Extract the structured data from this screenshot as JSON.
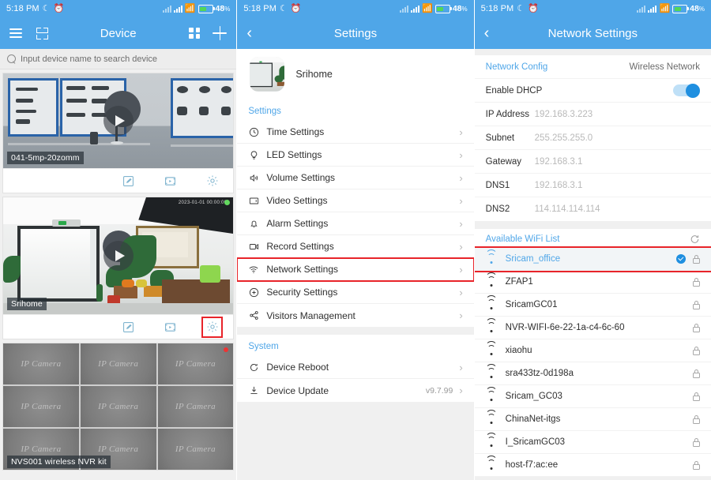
{
  "statusbar": {
    "time": "5:18 PM",
    "moon_icon": "crescent-moon-icon",
    "alarm_icon": "alarm-clock-icon",
    "battery_percent": "48",
    "battery_unit": "%"
  },
  "device_screen": {
    "title": "Device",
    "menu_icon": "hamburger-menu-icon",
    "scan_icon": "qr-scan-icon",
    "grid_icon": "grid-view-icon",
    "add_icon": "plus-add-icon",
    "search": {
      "icon": "search-icon",
      "placeholder": "Input device name to search device"
    },
    "cards": [
      {
        "label": "041-5mp-20zomm",
        "play_icon": "play-button-icon",
        "actions": [
          "edit-icon",
          "playback-icon",
          "settings-gear-icon"
        ],
        "highlight_gear": false
      },
      {
        "label": "Srihome",
        "play_icon": "play-button-icon",
        "actions": [
          "edit-icon",
          "playback-icon",
          "settings-gear-icon"
        ],
        "highlight_gear": true
      },
      {
        "label": "NVS001 wireless NVR kit",
        "channel_label": "IP Camera",
        "channels": 9
      }
    ]
  },
  "settings_screen": {
    "title": "Settings",
    "back_icon": "chevron-left-icon",
    "profile": {
      "name": "Srihome",
      "avatar": "device-thumbnail-avatar"
    },
    "sections": [
      {
        "header": "Settings",
        "items": [
          {
            "label": "Time Settings",
            "icon": "clock-icon",
            "highlight": false
          },
          {
            "label": "LED Settings",
            "icon": "lightbulb-icon",
            "highlight": false
          },
          {
            "label": "Volume Settings",
            "icon": "speaker-icon",
            "highlight": false
          },
          {
            "label": "Video Settings",
            "icon": "video-screen-icon",
            "highlight": false
          },
          {
            "label": "Alarm Settings",
            "icon": "bell-icon",
            "highlight": false
          },
          {
            "label": "Record Settings",
            "icon": "camcorder-icon",
            "highlight": false
          },
          {
            "label": "Network Settings",
            "icon": "wifi-icon",
            "highlight": true
          },
          {
            "label": "Security Settings",
            "icon": "shield-plus-icon",
            "highlight": false
          },
          {
            "label": "Visitors Management",
            "icon": "share-nodes-icon",
            "highlight": false
          }
        ]
      },
      {
        "header": "System",
        "items": [
          {
            "label": "Device Reboot",
            "icon": "reboot-icon",
            "value": "",
            "highlight": false
          },
          {
            "label": "Device Update",
            "icon": "download-icon",
            "value": "v9.7.99",
            "highlight": false
          }
        ]
      }
    ],
    "chevron": "›"
  },
  "network_screen": {
    "title": "Network Settings",
    "back_icon": "chevron-left-icon",
    "config_header": "Network Config",
    "connection_type": "Wireless Network",
    "dhcp": {
      "label": "Enable DHCP",
      "enabled": true
    },
    "fields": [
      {
        "key": "IP Address",
        "value": "192.168.3.223"
      },
      {
        "key": "Subnet",
        "value": "255.255.255.0"
      },
      {
        "key": "Gateway",
        "value": "192.168.3.1"
      },
      {
        "key": "DNS1",
        "value": "192.168.3.1"
      },
      {
        "key": "DNS2",
        "value": "114.114.114.114"
      }
    ],
    "wifi_header": "Available WiFi List",
    "refresh_icon": "refresh-icon",
    "wifi_list": [
      {
        "ssid": "Sricam_office",
        "selected": true,
        "locked": true,
        "highlight": true
      },
      {
        "ssid": "ZFAP1",
        "selected": false,
        "locked": true,
        "highlight": false
      },
      {
        "ssid": "SricamGC01",
        "selected": false,
        "locked": true,
        "highlight": false
      },
      {
        "ssid": "NVR-WIFI-6e-22-1a-c4-6c-60",
        "selected": false,
        "locked": true,
        "highlight": false
      },
      {
        "ssid": "xiaohu",
        "selected": false,
        "locked": true,
        "highlight": false
      },
      {
        "ssid": "sra433tz-0d198a",
        "selected": false,
        "locked": true,
        "highlight": false
      },
      {
        "ssid": "Sricam_GC03",
        "selected": false,
        "locked": true,
        "highlight": false
      },
      {
        "ssid": "ChinaNet-itgs",
        "selected": false,
        "locked": true,
        "highlight": false
      },
      {
        "ssid": "I_SricamGC03",
        "selected": false,
        "locked": true,
        "highlight": false
      },
      {
        "ssid": "host-f7:ac:ee",
        "selected": false,
        "locked": true,
        "highlight": false
      }
    ]
  },
  "colors": {
    "header_blue": "#4FA6E8",
    "accent_blue": "#1F8FE0",
    "highlight_red": "#E8242A",
    "icon_teal": "#7FB4CF"
  }
}
